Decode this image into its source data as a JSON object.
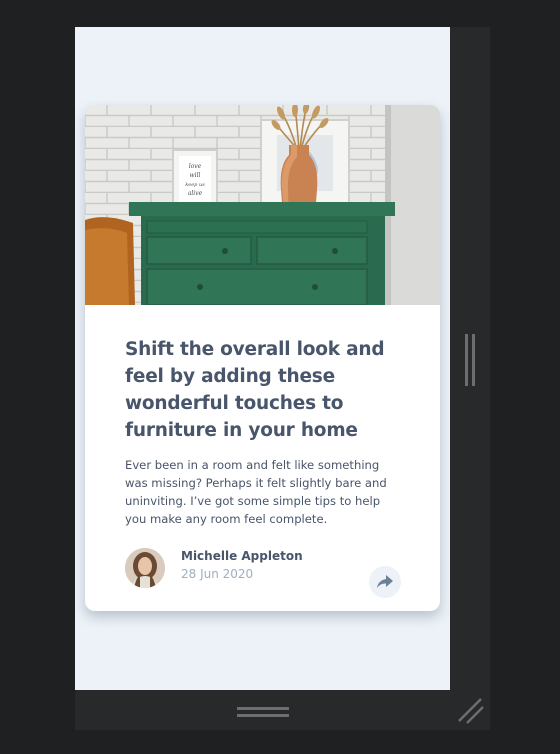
{
  "article": {
    "title": "Shift the overall look and feel by adding these wonderful touches to furniture in your home",
    "description": "Ever been in a room and felt like something was missing? Perhaps it felt slightly bare and uninviting. I’ve got some simple tips to help you make any room feel complete.",
    "author": {
      "name": "Michelle Appleton",
      "date": "28 Jun 2020"
    },
    "hero_image": {
      "frame_text": "love will keep us alive"
    },
    "share_icon": "share-icon"
  },
  "colors": {
    "page_bg": "#ecf2f8",
    "card_bg": "#ffffff",
    "text_dark": "#48556a",
    "text_muted": "#9eafc2",
    "dresser_green": "#2e7054",
    "frame_bg": "#1f2022"
  },
  "chrome": {
    "resize_handles": [
      "vertical-resize-handle",
      "horizontal-resize-handle",
      "corner-resize-handle"
    ]
  }
}
